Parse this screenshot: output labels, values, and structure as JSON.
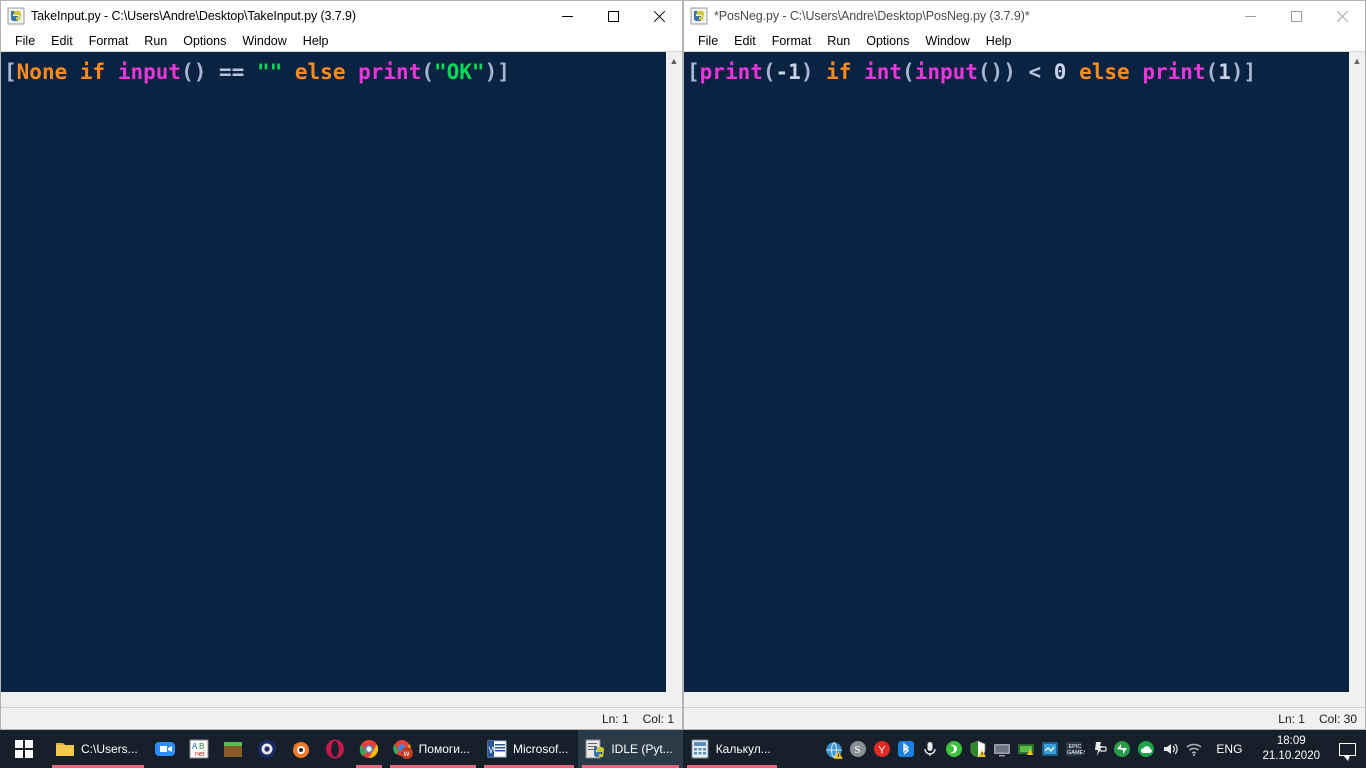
{
  "windows": [
    {
      "id": "left",
      "icon_name": "python-idle-icon",
      "title": "TakeInput.py - C:\\Users\\Andre\\Desktop\\TakeInput.py (3.7.9)",
      "active": true,
      "menus": [
        "File",
        "Edit",
        "Format",
        "Run",
        "Options",
        "Window",
        "Help"
      ],
      "buttons": {
        "minimize": "minimize",
        "maximize": "maximize",
        "close": "close"
      },
      "code_tokens": [
        {
          "t": "[",
          "c": "bracket"
        },
        {
          "t": "None",
          "c": "kw"
        },
        {
          "t": " ",
          "c": "op"
        },
        {
          "t": "if",
          "c": "kw"
        },
        {
          "t": " ",
          "c": "op"
        },
        {
          "t": "input",
          "c": "builtin"
        },
        {
          "t": "()",
          "c": "paren"
        },
        {
          "t": " == ",
          "c": "op"
        },
        {
          "t": "\"\"",
          "c": "string"
        },
        {
          "t": " ",
          "c": "op"
        },
        {
          "t": "else",
          "c": "kw"
        },
        {
          "t": " ",
          "c": "op"
        },
        {
          "t": "print",
          "c": "builtin"
        },
        {
          "t": "(",
          "c": "paren"
        },
        {
          "t": "\"OK\"",
          "c": "string"
        },
        {
          "t": ")",
          "c": "paren"
        },
        {
          "t": "]",
          "c": "bracket"
        }
      ],
      "status": {
        "line": "Ln: 1",
        "col": "Col: 1"
      }
    },
    {
      "id": "right",
      "icon_name": "python-idle-icon",
      "title": "*PosNeg.py - C:\\Users\\Andre\\Desktop\\PosNeg.py (3.7.9)*",
      "active": false,
      "menus": [
        "File",
        "Edit",
        "Format",
        "Run",
        "Options",
        "Window",
        "Help"
      ],
      "buttons": {
        "minimize": "minimize",
        "maximize": "maximize",
        "close": "close"
      },
      "code_tokens": [
        {
          "t": "[",
          "c": "bracket"
        },
        {
          "t": "print",
          "c": "builtin"
        },
        {
          "t": "(",
          "c": "paren"
        },
        {
          "t": "-1",
          "c": "num"
        },
        {
          "t": ")",
          "c": "paren"
        },
        {
          "t": " ",
          "c": "op"
        },
        {
          "t": "if",
          "c": "kw"
        },
        {
          "t": " ",
          "c": "op"
        },
        {
          "t": "int",
          "c": "builtin"
        },
        {
          "t": "(",
          "c": "paren"
        },
        {
          "t": "input",
          "c": "builtin"
        },
        {
          "t": "())",
          "c": "paren"
        },
        {
          "t": " < ",
          "c": "op"
        },
        {
          "t": "0",
          "c": "num"
        },
        {
          "t": " ",
          "c": "op"
        },
        {
          "t": "else",
          "c": "kw"
        },
        {
          "t": " ",
          "c": "op"
        },
        {
          "t": "print",
          "c": "builtin"
        },
        {
          "t": "(",
          "c": "paren"
        },
        {
          "t": "1",
          "c": "num"
        },
        {
          "t": ")",
          "c": "paren"
        },
        {
          "t": "]",
          "c": "bracket"
        }
      ],
      "status": {
        "line": "Ln: 1",
        "col": "Col: 30"
      }
    }
  ],
  "colors": {
    "editor_bg": "#0a2342",
    "keyword": "#ff8c1a",
    "builtin": "#e838d8",
    "string": "#00dd55",
    "bracket": "#a8b4d4",
    "taskbar_bg": "#15202b",
    "task_underline": "#e8677d"
  },
  "taskbar": {
    "start_label": "Start",
    "items": [
      {
        "icon": "folder-icon",
        "label": "C:\\Users...",
        "underline": true,
        "active": false,
        "wide": true
      },
      {
        "icon": "zoom-icon",
        "label": "",
        "underline": false,
        "active": false,
        "wide": false
      },
      {
        "icon": "abbyy-icon",
        "label": "",
        "underline": false,
        "active": false,
        "wide": false
      },
      {
        "icon": "minecraft-icon",
        "label": "",
        "underline": false,
        "active": false,
        "wide": false
      },
      {
        "icon": "cinema4d-icon",
        "label": "",
        "underline": false,
        "active": false,
        "wide": false
      },
      {
        "icon": "blender-icon",
        "label": "",
        "underline": false,
        "active": false,
        "wide": false
      },
      {
        "icon": "opera-icon",
        "label": "",
        "underline": false,
        "active": false,
        "wide": false
      },
      {
        "icon": "chrome-icon",
        "label": "",
        "underline": true,
        "active": false,
        "wide": false
      },
      {
        "icon": "chrome-word-icon",
        "label": "Помоги...",
        "underline": true,
        "active": false,
        "wide": true
      },
      {
        "icon": "word-icon",
        "label": "Microsof...",
        "underline": true,
        "active": false,
        "wide": true
      },
      {
        "icon": "idle-icon",
        "label": "IDLE (Pyt...",
        "underline": true,
        "active": true,
        "wide": true
      },
      {
        "icon": "calculator-icon",
        "label": "Калькул...",
        "underline": true,
        "active": false,
        "wide": true
      }
    ],
    "tray": [
      {
        "icon": "network-warning-icon"
      },
      {
        "icon": "skype-icon"
      },
      {
        "icon": "yandex-icon"
      },
      {
        "icon": "bluetooth-icon"
      },
      {
        "icon": "microphone-icon"
      },
      {
        "icon": "nvidia-icon"
      },
      {
        "icon": "kaspersky-icon"
      },
      {
        "icon": "security-warning-icon"
      },
      {
        "icon": "display-icon"
      },
      {
        "icon": "graphics-icon"
      },
      {
        "icon": "network-settings-icon"
      },
      {
        "icon": "epic-games-icon"
      },
      {
        "icon": "battery-icon"
      },
      {
        "icon": "onedrive-icon"
      },
      {
        "icon": "volume-icon"
      },
      {
        "icon": "wifi-icon"
      }
    ],
    "language": "ENG",
    "clock": {
      "time": "18:09",
      "date": "21.10.2020"
    },
    "action_center": "notifications-icon"
  }
}
